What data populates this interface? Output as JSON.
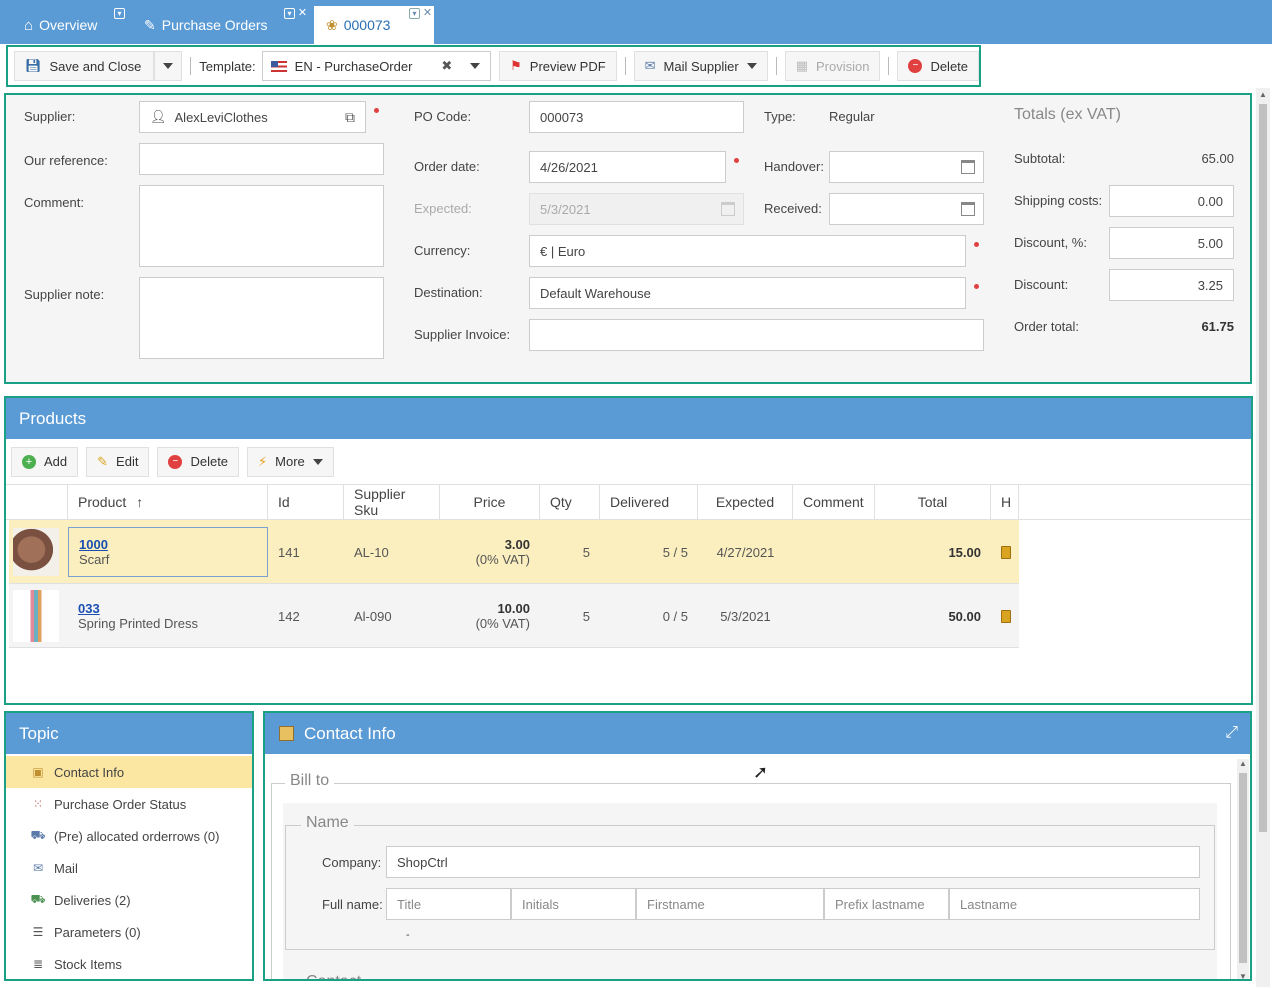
{
  "tabs": [
    {
      "label": "Overview"
    },
    {
      "label": "Purchase Orders"
    },
    {
      "label": "000073"
    }
  ],
  "toolbar": {
    "save_close": "Save and Close",
    "template_label": "Template:",
    "template_value": "EN - PurchaseOrder",
    "preview_pdf": "Preview PDF",
    "mail_supplier": "Mail Supplier",
    "provision": "Provision",
    "delete": "Delete"
  },
  "header": {
    "supplier_label": "Supplier:",
    "supplier_value": "AlexLeviClothes",
    "our_reference_label": "Our reference:",
    "our_reference_value": "",
    "comment_label": "Comment:",
    "supplier_note_label": "Supplier note:",
    "po_code_label": "PO Code:",
    "po_code_value": "000073",
    "type_label": "Type:",
    "type_value": "Regular",
    "order_date_label": "Order date:",
    "order_date_value": "4/26/2021",
    "handover_label": "Handover:",
    "expected_label": "Expected:",
    "expected_value": "5/3/2021",
    "received_label": "Received:",
    "currency_label": "Currency:",
    "currency_value": "€ | Euro",
    "destination_label": "Destination:",
    "destination_value": "Default Warehouse",
    "supplier_invoice_label": "Supplier Invoice:"
  },
  "totals": {
    "title": "Totals (ex VAT)",
    "subtotal_label": "Subtotal:",
    "subtotal_value": "65.00",
    "shipping_label": "Shipping costs:",
    "shipping_value": "0.00",
    "discount_pct_label": "Discount, %:",
    "discount_pct_value": "5.00",
    "discount_label": "Discount:",
    "discount_value": "3.25",
    "order_total_label": "Order total:",
    "order_total_value": "61.75"
  },
  "products": {
    "title": "Products",
    "buttons": {
      "add": "Add",
      "edit": "Edit",
      "delete": "Delete",
      "more": "More"
    },
    "columns": [
      "Product",
      "Id",
      "Supplier Sku",
      "Price",
      "Qty",
      "Delivered",
      "Expected",
      "Comment",
      "Total",
      "H"
    ],
    "rows": [
      {
        "code": "1000",
        "name": "Scarf",
        "id": "141",
        "sku": "AL-10",
        "price": "3.00",
        "vat": "(0% VAT)",
        "qty": "5",
        "delivered": "5 / 5",
        "expected": "4/27/2021",
        "comment": "",
        "total": "15.00"
      },
      {
        "code": "033",
        "name": "Spring Printed Dress",
        "id": "142",
        "sku": "Al-090",
        "price": "10.00",
        "vat": "(0% VAT)",
        "qty": "5",
        "delivered": "0 / 5",
        "expected": "5/3/2021",
        "comment": "",
        "total": "50.00"
      }
    ]
  },
  "topic": {
    "title": "Topic",
    "items": [
      {
        "label": "Contact Info"
      },
      {
        "label": "Purchase Order Status"
      },
      {
        "label": "(Pre) allocated orderrows (0)"
      },
      {
        "label": "Mail"
      },
      {
        "label": "Deliveries (2)"
      },
      {
        "label": "Parameters (0)"
      },
      {
        "label": "Stock Items"
      }
    ]
  },
  "contact": {
    "title": "Contact Info",
    "bill_to": "Bill to",
    "name_legend": "Name",
    "company_label": "Company:",
    "company_value": "ShopCtrl",
    "fullname_label": "Full name:",
    "ph_title": "Title",
    "ph_initials": "Initials",
    "ph_firstname": "Firstname",
    "ph_prefix": "Prefix lastname",
    "ph_lastname": "Lastname",
    "dash": "-",
    "contact_legend": "Contact"
  },
  "colors": {
    "accent": "#5b9bd5",
    "highlight_border": "#1aa085",
    "selected_row": "#fbefc0"
  }
}
